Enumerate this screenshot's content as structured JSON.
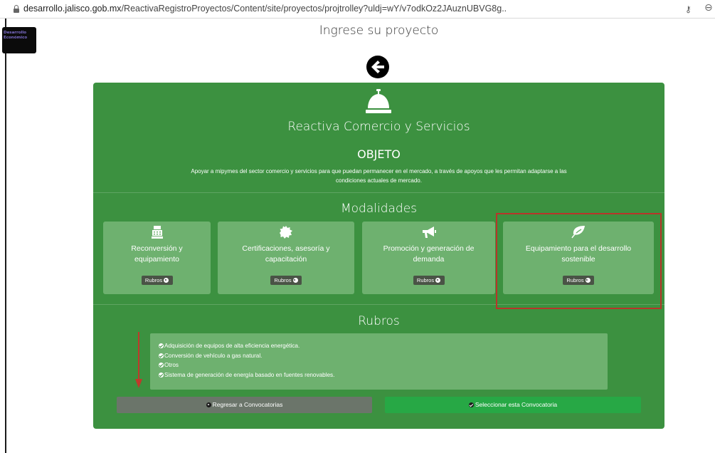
{
  "browser": {
    "url_host": "desarrollo.jalisco.gob.mx",
    "url_path": "/ReactivaRegistroProyectos/Content/site/proyectos/projtrolley?uldj=wY/v7odkOz2JAuznUBVG8g.."
  },
  "logo": {
    "line1": "Desarrollo",
    "line2": "Económico"
  },
  "page": {
    "heading": "Ingrese su proyecto"
  },
  "program": {
    "title": "Reactiva Comercio y Servicios",
    "objeto_heading": "OBJETO",
    "objeto_text": "Apoyar a mipymes del sector comercio y servicios para que puedan permanecer en el mercado, a través de apoyos que les permitan adaptarse a las condiciones actuales de mercado."
  },
  "modalidades": {
    "heading": "Modalidades",
    "cards": [
      {
        "label": "Reconversión y equipamiento",
        "button": "Rubros",
        "icon": "cash-register-icon"
      },
      {
        "label": "Certificaciones, asesoría y capacitación",
        "button": "Rubros",
        "icon": "certificate-icon"
      },
      {
        "label": "Promoción y generación de demanda",
        "button": "Rubros",
        "icon": "megaphone-icon"
      },
      {
        "label": "Equipamiento para el desarrollo sostenible",
        "button": "Rubros",
        "icon": "leaf-icon"
      }
    ]
  },
  "rubros": {
    "heading": "Rubros",
    "items": [
      "Adquisición de equipos de alta eficiencia energética.",
      "Conversión de vehículo a gas natural.",
      "Otros",
      "Sistema de generación de energía basado en fuentes renovables."
    ]
  },
  "actions": {
    "back": "Regresar a Convocatorias",
    "select": "Seleccionar esta Convocatoria"
  },
  "colors": {
    "panel": "#3c9140",
    "card": "#6eb16f",
    "select_button": "#27a845",
    "back_button": "#6b756a",
    "highlight": "#b8352a"
  }
}
